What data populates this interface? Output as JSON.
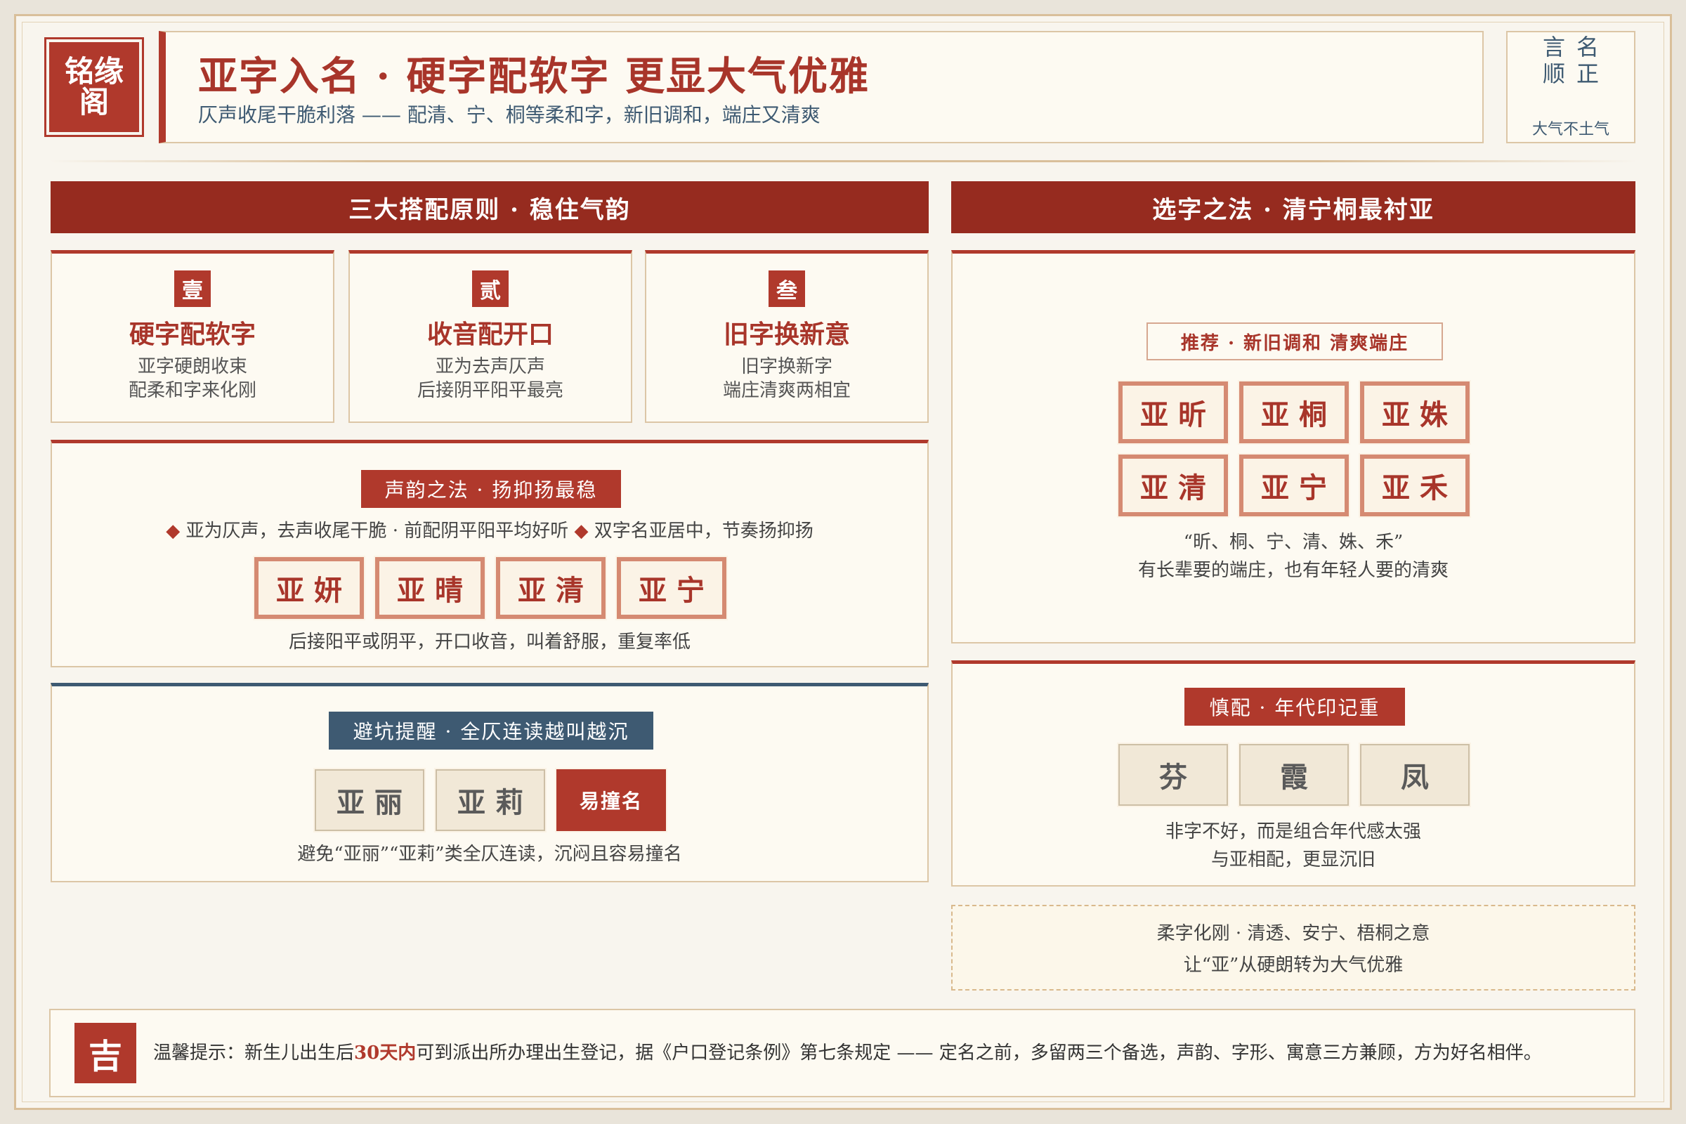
{
  "header": {
    "logo_line1": "铭缘",
    "logo_line2": "阁",
    "title": "亚字入名 · 硬字配软字 更显大气优雅",
    "subtitle": "仄声收尾干脆利落 —— 配清、宁、桐等柔和字，新旧调和，端庄又清爽",
    "seal_row1": "言名",
    "seal_row2": "顺正",
    "seal_foot": "大气不土气"
  },
  "left_section": {
    "bar": "三大搭配原则 · 稳住气韵",
    "principles": [
      {
        "num": "壹",
        "title": "硬字配软字",
        "line1": "亚字硬朗收束",
        "line2": "配柔和字来化刚"
      },
      {
        "num": "贰",
        "title": "收音配开口",
        "line1": "亚为去声仄声",
        "line2": "后接阴平阳平最亮"
      },
      {
        "num": "叁",
        "title": "旧字换新意",
        "line1": "旧字换新字",
        "line2": "端庄清爽两相宜"
      }
    ],
    "tone": {
      "pill": "声韵之法 · 扬抑扬最稳",
      "bullet1": "亚为仄声，去声收尾干脆 · 前配阴平阳平均好听",
      "bullet2": "双字名亚居中，节奏扬抑扬",
      "names": [
        "亚妍",
        "亚晴",
        "亚清",
        "亚宁"
      ],
      "caption": "后接阳平或阴平，开口收音，叫着舒服，重复率低"
    },
    "avoid": {
      "pill": "避坑提醒 · 全仄连读越叫越沉",
      "names": [
        "亚丽",
        "亚莉"
      ],
      "tag": "易撞名",
      "caption": "避免“亚丽”“亚莉”类全仄连读，沉闷且容易撞名"
    }
  },
  "right_section": {
    "bar": "选字之法 · 清宁桐最衬亚",
    "recommend": {
      "pill": "推荐 · 新旧调和 清爽端庄",
      "names": [
        "亚昕",
        "亚桐",
        "亚姝",
        "亚清",
        "亚宁",
        "亚禾"
      ],
      "caption1": "“昕、桐、宁、清、姝、禾”",
      "caption2": "有长辈要的端庄，也有年轻人要的清爽"
    },
    "caution": {
      "pill": "慎配 · 年代印记重",
      "chars": [
        "芬",
        "霞",
        "凤"
      ],
      "caption1": "非字不好，而是组合年代感太强",
      "caption2": "与亚相配，更显沉旧"
    },
    "note1": "柔字化刚 · 清透、安宁、梧桐之意",
    "note2": "让“亚”从硬朗转为大气优雅"
  },
  "footer": {
    "badge": "吉",
    "text_pre": "温馨提示：新生儿出生后",
    "text_hl": "30天内",
    "text_post": "可到派出所办理出生登记，据《户口登记条例》第七条规定 —— 定名之前，多留两三个备选，声韵、字形、寓意三方兼顾，方为好名相伴。"
  },
  "colors": {
    "primary_red": "#b0392c",
    "dark_red": "#962b1f",
    "slate_blue": "#3e5a72",
    "paper": "#fdfaf2",
    "gold_border": "#dcc6a6"
  }
}
